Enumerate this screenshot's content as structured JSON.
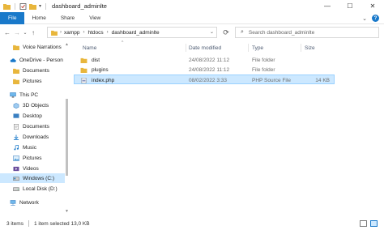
{
  "window": {
    "title": "dashboard_adminlte",
    "controls": {
      "minimize": "—",
      "maximize": "☐",
      "close": "✕"
    }
  },
  "ribbon": {
    "tabs": [
      "File",
      "Home",
      "Share",
      "View"
    ],
    "expand": "⌄",
    "help": "?"
  },
  "address": {
    "back": "←",
    "forward": "→",
    "recent": "⌄",
    "up": "↑",
    "crumbs": [
      "xampp",
      "htdocs",
      "dashboard_adminlte"
    ],
    "crumb_sep": "›",
    "drop": "⌄",
    "refresh": "⟳",
    "search_icon": "⌕",
    "search_placeholder": "Search dashboard_adminlte"
  },
  "nav": {
    "items": [
      {
        "label": "Voice Narrations",
        "icon": "folder-icon",
        "selected": false
      },
      {
        "label": "OneDrive - Person",
        "icon": "cloud-icon",
        "selected": false
      },
      {
        "label": "Documents",
        "icon": "folder-icon",
        "selected": false
      },
      {
        "label": "Pictures",
        "icon": "folder-icon",
        "selected": false
      },
      {
        "label": "This PC",
        "icon": "computer-icon",
        "selected": false
      },
      {
        "label": "3D Objects",
        "icon": "cube-icon",
        "selected": false
      },
      {
        "label": "Desktop",
        "icon": "desktop-icon",
        "selected": false
      },
      {
        "label": "Documents",
        "icon": "documents-icon",
        "selected": false
      },
      {
        "label": "Downloads",
        "icon": "download-icon",
        "selected": false
      },
      {
        "label": "Music",
        "icon": "music-icon",
        "selected": false
      },
      {
        "label": "Pictures",
        "icon": "pictures-icon",
        "selected": false
      },
      {
        "label": "Videos",
        "icon": "videos-icon",
        "selected": false
      },
      {
        "label": "Windows (C:)",
        "icon": "drive-icon",
        "selected": true
      },
      {
        "label": "Local Disk (D:)",
        "icon": "drive-icon",
        "selected": false
      },
      {
        "label": "Network",
        "icon": "network-icon",
        "selected": false
      }
    ]
  },
  "files": {
    "columns": {
      "name": "Name",
      "date": "Date modified",
      "type": "Type",
      "size": "Size"
    },
    "sort_arrow": "^",
    "rows": [
      {
        "name": "dist",
        "date": "24/08/2022 11:12",
        "type": "File folder",
        "size": "",
        "icon": "folder-icon",
        "selected": false
      },
      {
        "name": "plugins",
        "date": "24/08/2022 11:12",
        "type": "File folder",
        "size": "",
        "icon": "folder-icon",
        "selected": false
      },
      {
        "name": "index.php",
        "date": "08/02/2022 3:33",
        "type": "PHP Source File",
        "size": "14 KB",
        "icon": "php-file-icon",
        "selected": true
      }
    ]
  },
  "status": {
    "count": "3 items",
    "selection": "1 item selected  13,0 KB"
  },
  "colors": {
    "accent": "#1979ca",
    "selection_bg": "#cce8ff",
    "folder": "#e8b63c"
  }
}
